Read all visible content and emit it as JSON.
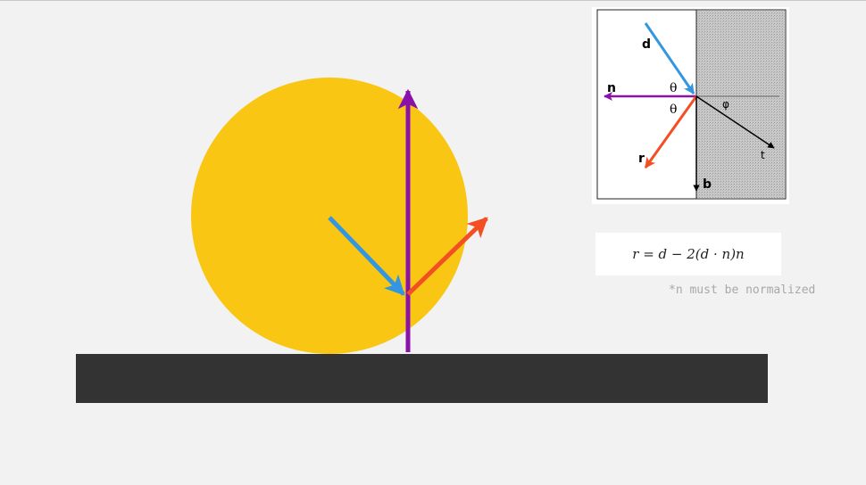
{
  "scene": {
    "colors": {
      "background": "#f2f2f2",
      "ball": "#f9c614",
      "floor": "#333333",
      "incident": "#3396e0",
      "normal": "#8a12a8",
      "reflected": "#f24f23"
    }
  },
  "inset": {
    "labels": {
      "d": "d",
      "n": "n",
      "theta_top": "θ",
      "theta_bottom": "θ",
      "phi": "φ",
      "r": "r",
      "t": "t",
      "b": "b"
    }
  },
  "formula": {
    "text": "r = d − 2(d · n)n"
  },
  "note": {
    "text": "*n must be normalized"
  }
}
